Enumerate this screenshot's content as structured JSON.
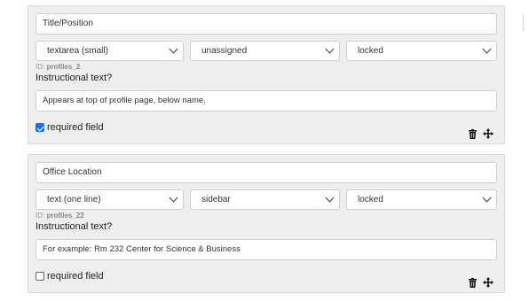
{
  "fields": [
    {
      "title_value": "Title/Position",
      "type": "textarea (small)",
      "position": "unassigned",
      "lock": "locked",
      "id_label": "ID:",
      "id_value": "profiles_2",
      "instructional_label": "Instructional text?",
      "instructional_value": "Appears at top of profile page, below name.",
      "required_label": "required field",
      "required_checked": true
    },
    {
      "title_value": "Office Location",
      "type": "text (one line)",
      "position": "sidebar",
      "lock": "locked",
      "id_label": "ID:",
      "id_value": "profiles_22",
      "instructional_label": "Instructional text?",
      "instructional_value": "For example: Rm 232 Center for Science & Business",
      "required_label": "required field",
      "required_checked": false
    }
  ],
  "icons": {
    "delete": "trash-icon",
    "reorder": "move-icon"
  },
  "colors": {
    "card_bg": "#eeeeee",
    "checkbox_accent": "#1a73e8"
  }
}
